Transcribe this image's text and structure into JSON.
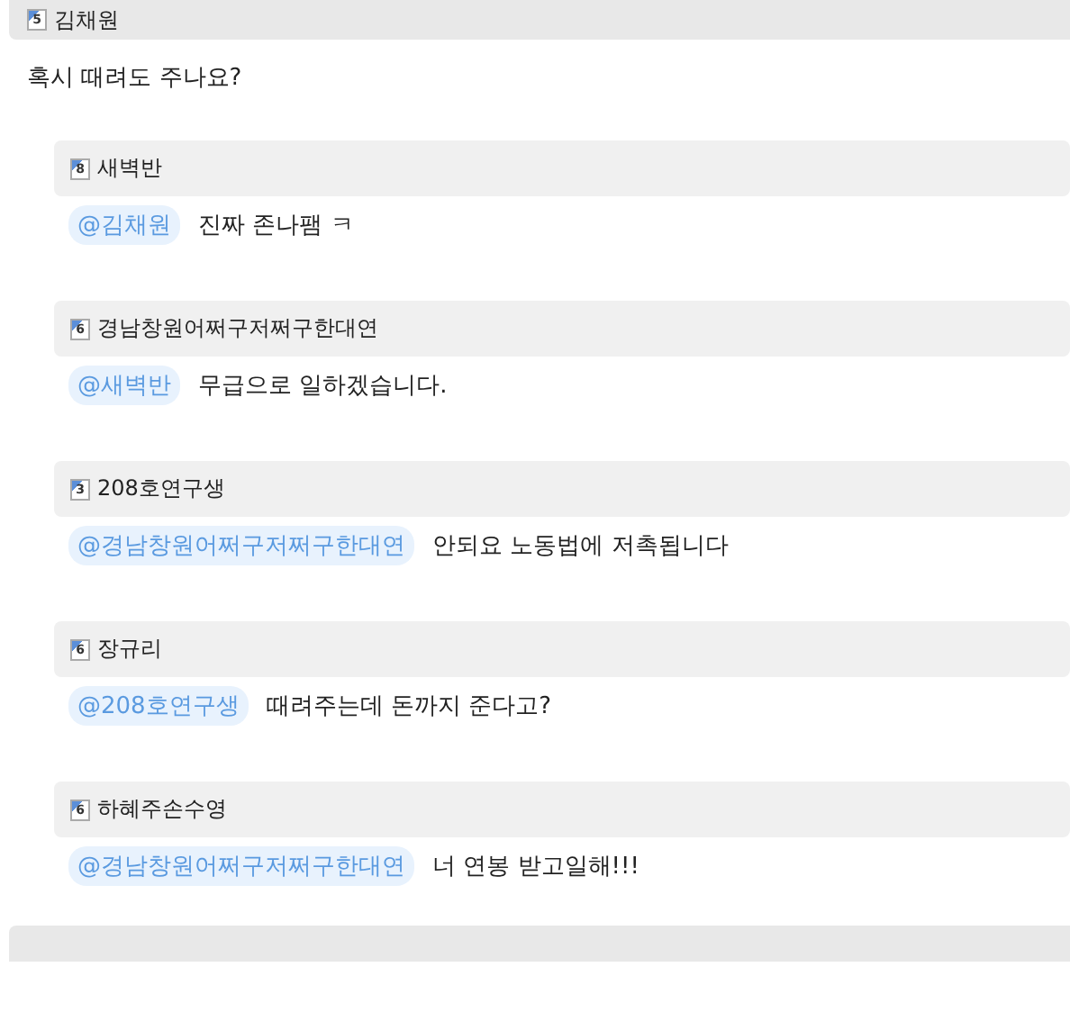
{
  "post": {
    "author": "김채원",
    "level": "5",
    "text": "혹시 때려도 주나요?"
  },
  "replies": [
    {
      "author": "새벽반",
      "level": "8",
      "mention": "@김채원",
      "text": "진짜 존나팸 ㅋ"
    },
    {
      "author": "경남창원어쩌구저쩌구한대연",
      "level": "6",
      "mention": "@새벽반",
      "text": "무급으로 일하겠습니다."
    },
    {
      "author": "208호연구생",
      "level": "3",
      "mention": "@경남창원어쩌구저쩌구한대연",
      "text": "안되요 노동법에 저촉됩니다"
    },
    {
      "author": "장규리",
      "level": "6",
      "mention": "@208호연구생",
      "text": "때려주는데 돈까지 준다고?"
    },
    {
      "author": "하혜주손수영",
      "level": "6",
      "mention": "@경남창원어쩌구저쩌구한대연",
      "text": "너 연봉 받고일해!!!"
    }
  ]
}
